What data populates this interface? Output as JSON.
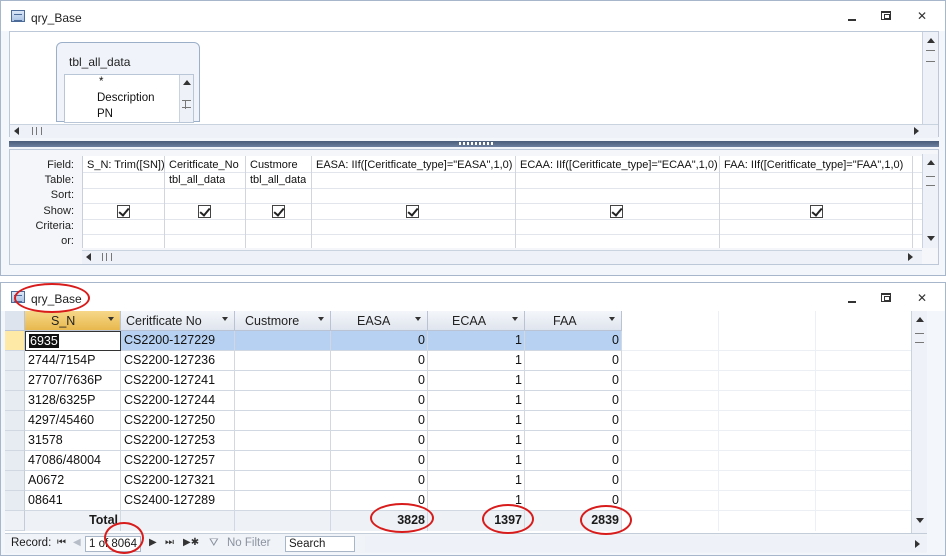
{
  "design_window": {
    "title": "qry_Base",
    "field_list": {
      "table_name": "tbl_all_data",
      "items": [
        "*",
        "Description",
        "PN"
      ]
    },
    "qbe": {
      "row_labels": [
        "Field:",
        "Table:",
        "Sort:",
        "Show:",
        "Criteria:",
        "or:"
      ],
      "columns": [
        {
          "field": "S_N: Trim([SN])",
          "table": "",
          "show": true
        },
        {
          "field": "Ceritficate_No",
          "table": "tbl_all_data",
          "show": true
        },
        {
          "field": "Custmore",
          "table": "tbl_all_data",
          "show": true
        },
        {
          "field": "EASA: IIf([Ceritficate_type]=\"EASA\",1,0)",
          "table": "",
          "show": true
        },
        {
          "field": "ECAA: IIf([Ceritficate_type]=\"ECAA\",1,0)",
          "table": "",
          "show": true
        },
        {
          "field": "FAA: IIf([Ceritficate_type]=\"FAA\",1,0)",
          "table": "",
          "show": true
        }
      ]
    }
  },
  "datasheet_window": {
    "title": "qry_Base",
    "columns": [
      "S_N",
      "Ceritficate No",
      "Custmore",
      "EASA",
      "ECAA",
      "FAA"
    ],
    "rows": [
      [
        "6935",
        "CS2200-127229",
        "",
        "0",
        "1",
        "0"
      ],
      [
        "2744/7154P",
        "CS2200-127236",
        "",
        "0",
        "1",
        "0"
      ],
      [
        "27707/7636P",
        "CS2200-127241",
        "",
        "0",
        "1",
        "0"
      ],
      [
        "3128/6325P",
        "CS2200-127244",
        "",
        "0",
        "1",
        "0"
      ],
      [
        "4297/45460",
        "CS2200-127250",
        "",
        "0",
        "1",
        "0"
      ],
      [
        "31578",
        "CS2200-127253",
        "",
        "0",
        "1",
        "0"
      ],
      [
        "47086/48004",
        "CS2200-127257",
        "",
        "0",
        "1",
        "0"
      ],
      [
        "A0672",
        "CS2200-127321",
        "",
        "0",
        "1",
        "0"
      ],
      [
        "08641",
        "CS2400-127289",
        "",
        "0",
        "1",
        "0"
      ]
    ],
    "total_label": "Total",
    "totals": {
      "easa": "3828",
      "ecaa": "1397",
      "faa": "2839"
    },
    "status": {
      "record_label": "Record:",
      "record_of": "1 of 8064",
      "no_filter": "No Filter",
      "search": "Search"
    }
  },
  "colors": {
    "annotation": "#d81c1c",
    "selection": "#b6d1f1",
    "active_header": "#e8b84d"
  }
}
